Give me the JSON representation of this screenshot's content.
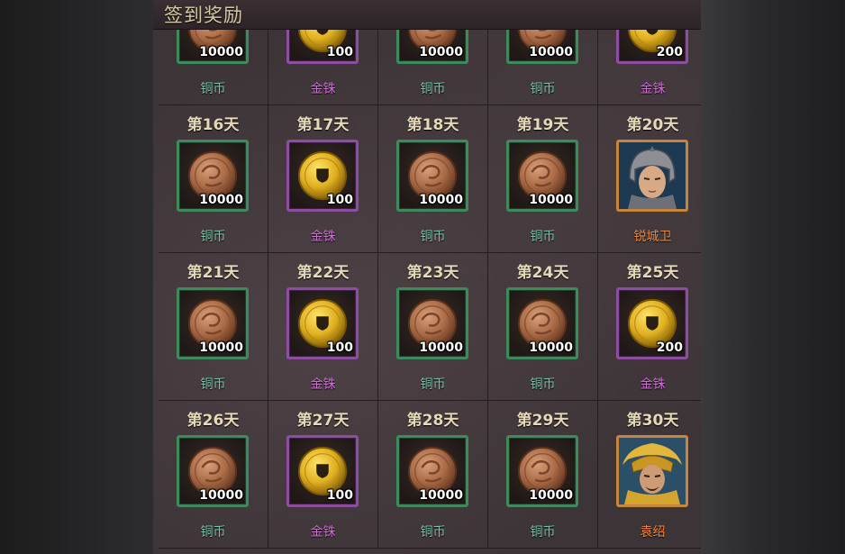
{
  "window": {
    "title": "签到奖励"
  },
  "colors": {
    "copper_label": "#6fc7a5",
    "gold_label": "#d36ad9",
    "hero_label": "#f08a3c",
    "green_frame": "#3f8a5a",
    "purple_frame": "#8b4ea0",
    "orange_frame": "#c7843a"
  },
  "rows": [
    {
      "cells": [
        {
          "day": "",
          "type": "copper",
          "icon": "copper-coin-icon",
          "qty": "10000",
          "label": "铜币"
        },
        {
          "day": "",
          "type": "gold",
          "icon": "gold-coin-icon",
          "qty": "100",
          "label": "金铢"
        },
        {
          "day": "",
          "type": "copper",
          "icon": "copper-coin-icon",
          "qty": "10000",
          "label": "铜币"
        },
        {
          "day": "",
          "type": "copper",
          "icon": "copper-coin-icon",
          "qty": "10000",
          "label": "铜币"
        },
        {
          "day": "",
          "type": "gold",
          "icon": "gold-coin-icon",
          "qty": "200",
          "label": "金铢"
        }
      ]
    },
    {
      "cells": [
        {
          "day": "第16天",
          "type": "copper",
          "icon": "copper-coin-icon",
          "qty": "10000",
          "label": "铜币"
        },
        {
          "day": "第17天",
          "type": "gold",
          "icon": "gold-coin-icon",
          "qty": "100",
          "label": "金铢"
        },
        {
          "day": "第18天",
          "type": "copper",
          "icon": "copper-coin-icon",
          "qty": "10000",
          "label": "铜币"
        },
        {
          "day": "第19天",
          "type": "copper",
          "icon": "copper-coin-icon",
          "qty": "10000",
          "label": "铜币"
        },
        {
          "day": "第20天",
          "type": "hero",
          "icon": "helmeted-soldier-portrait-icon",
          "qty": "",
          "label": "锐城卫"
        }
      ]
    },
    {
      "cells": [
        {
          "day": "第21天",
          "type": "copper",
          "icon": "copper-coin-icon",
          "qty": "10000",
          "label": "铜币"
        },
        {
          "day": "第22天",
          "type": "gold",
          "icon": "gold-coin-icon",
          "qty": "100",
          "label": "金铢"
        },
        {
          "day": "第23天",
          "type": "copper",
          "icon": "copper-coin-icon",
          "qty": "10000",
          "label": "铜币"
        },
        {
          "day": "第24天",
          "type": "copper",
          "icon": "copper-coin-icon",
          "qty": "10000",
          "label": "铜币"
        },
        {
          "day": "第25天",
          "type": "gold",
          "icon": "gold-coin-icon",
          "qty": "200",
          "label": "金铢"
        }
      ]
    },
    {
      "cells": [
        {
          "day": "第26天",
          "type": "copper",
          "icon": "copper-coin-icon",
          "qty": "10000",
          "label": "铜币"
        },
        {
          "day": "第27天",
          "type": "gold",
          "icon": "gold-coin-icon",
          "qty": "100",
          "label": "金铢"
        },
        {
          "day": "第28天",
          "type": "copper",
          "icon": "copper-coin-icon",
          "qty": "10000",
          "label": "铜币"
        },
        {
          "day": "第29天",
          "type": "copper",
          "icon": "copper-coin-icon",
          "qty": "10000",
          "label": "铜币"
        },
        {
          "day": "第30天",
          "type": "hero",
          "icon": "golden-armored-general-portrait-icon",
          "qty": "",
          "label": "袁绍"
        }
      ]
    }
  ]
}
